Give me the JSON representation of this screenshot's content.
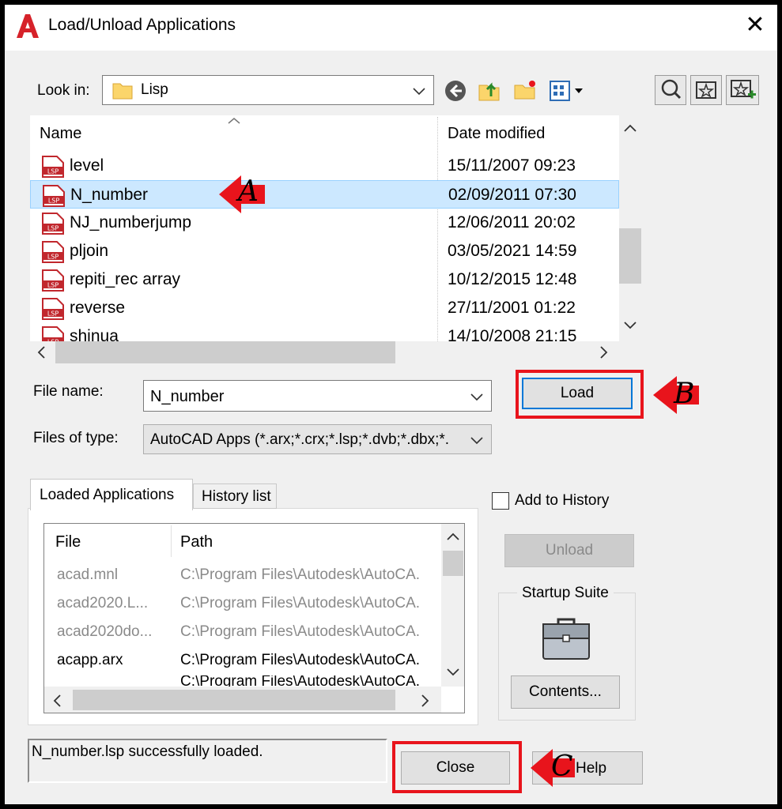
{
  "window": {
    "title": "Load/Unload Applications",
    "close_glyph": "✕"
  },
  "look_in": {
    "label": "Look in:",
    "value": "Lisp"
  },
  "file_list": {
    "col_name": "Name",
    "col_date": "Date modified",
    "rows": [
      {
        "name": "level",
        "date": "15/11/2007 09:23"
      },
      {
        "name": "N_number",
        "date": "02/09/2011 07:30",
        "selected": true
      },
      {
        "name": "NJ_numberjump",
        "date": "12/06/2011 20:02"
      },
      {
        "name": "pljoin",
        "date": "03/05/2021 14:59"
      },
      {
        "name": "repiti_rec array",
        "date": "10/12/2015 12:48"
      },
      {
        "name": "reverse",
        "date": "27/11/2001 01:22"
      },
      {
        "name": "shinua",
        "date": "14/10/2008 21:15"
      }
    ],
    "icon_text": "LSP"
  },
  "file_name": {
    "label": "File name:",
    "value": "N_number"
  },
  "files_of_type": {
    "label": "Files of type:",
    "value": "AutoCAD Apps (*.arx;*.crx;*.lsp;*.dvb;*.dbx;*."
  },
  "buttons": {
    "load": "Load",
    "unload": "Unload",
    "contents": "Contents...",
    "close": "Close",
    "help": "Help"
  },
  "tabs": {
    "loaded": "Loaded Applications",
    "history": "History list"
  },
  "add_to_history": "Add to History",
  "startup_suite": "Startup Suite",
  "loaded_apps": {
    "col_file": "File",
    "col_path": "Path",
    "rows": [
      {
        "file": "acad.mnl",
        "path": "C:\\Program Files\\Autodesk\\AutoCA.",
        "grey": true
      },
      {
        "file": "acad2020.L...",
        "path": "C:\\Program Files\\Autodesk\\AutoCA.",
        "grey": true
      },
      {
        "file": "acad2020do...",
        "path": "C:\\Program Files\\Autodesk\\AutoCA.",
        "grey": true
      },
      {
        "file": "acapp.arx",
        "path": "C:\\Program Files\\Autodesk\\AutoCA.",
        "grey": false
      },
      {
        "file": "",
        "path": "C:\\Program Files\\Autodesk\\AutoCA.",
        "grey": false
      }
    ]
  },
  "status": "N_number.lsp successfully loaded.",
  "annotations": {
    "a": "A",
    "b": "B",
    "c": "C"
  },
  "colors": {
    "annotation_red": "#e8141c",
    "selection": "#cce8ff",
    "autocad_red": "#d6222a"
  }
}
